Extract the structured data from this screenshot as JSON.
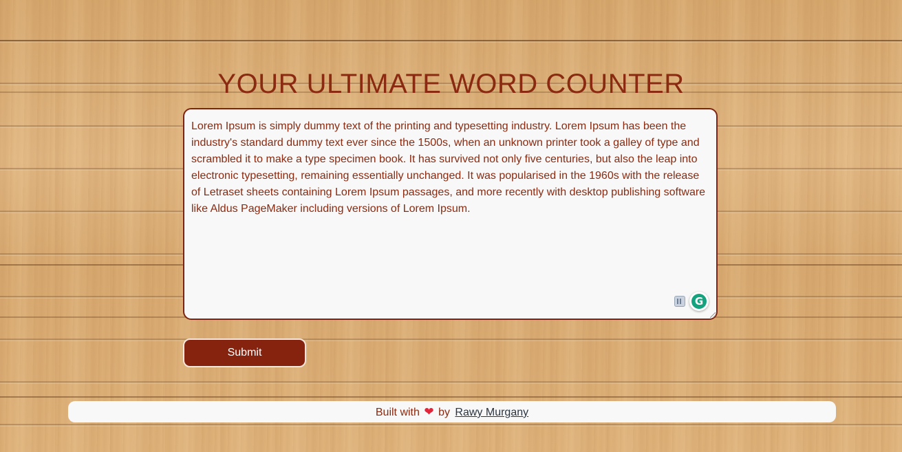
{
  "page": {
    "title": "YOUR ULTIMATE WORD COUNTER"
  },
  "editor": {
    "text": "Lorem Ipsum is simply dummy text of the printing and typesetting industry. Lorem Ipsum has been the industry's standard dummy text ever since the 1500s, when an unknown printer took a galley of type and scrambled it to make a type specimen book. It has survived not only five centuries, but also the leap into electronic typesetting, remaining essentially unchanged. It was popularised in the 1960s with the release of Letraset sheets containing Lorem Ipsum passages, and more recently with desktop publishing software like Aldus PageMaker including versions of Lorem Ipsum.",
    "grammarly_icon": "grammarly-icon",
    "extension_icon": "extension-icon"
  },
  "actions": {
    "submit_label": "Submit"
  },
  "footer": {
    "prefix": "Built with",
    "heart": "❤",
    "by": "by",
    "author": "Rawy Murgany"
  },
  "colors": {
    "accent": "#8a2a10",
    "button": "#85230f",
    "panel": "#f8f8f8",
    "heart": "#e0263a",
    "grammarly": "#15a37f"
  }
}
